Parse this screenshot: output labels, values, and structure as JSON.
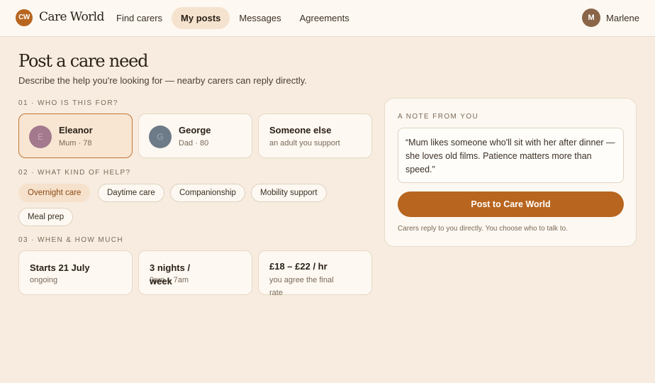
{
  "app": {
    "logo": "CW",
    "name": "Care World"
  },
  "nav": {
    "items": [
      "Find carers",
      "My posts",
      "Messages",
      "Agreements"
    ],
    "active": "My posts"
  },
  "user": {
    "initial": "M",
    "name": "Marlene"
  },
  "page": {
    "title": "Post a care need",
    "subtitle": "Describe the help you're looking for — nearby carers can reply directly."
  },
  "who": {
    "label": "01 · WHO IS THIS FOR?",
    "people": [
      {
        "name": "Eleanor",
        "meta": "Mum · 78",
        "initial": "E",
        "color": "#a3798d",
        "selected": true
      },
      {
        "name": "George",
        "meta": "Dad · 80",
        "initial": "G",
        "color": "#6d7a88",
        "selected": false
      },
      {
        "name": "Someone else",
        "meta": "an adult you support",
        "selected": false
      }
    ]
  },
  "help": {
    "label": "02 · WHAT KIND OF HELP?",
    "chips": [
      {
        "label": "Overnight care",
        "active": true
      },
      {
        "label": "Daytime care",
        "active": false
      },
      {
        "label": "Companionship",
        "active": false
      },
      {
        "label": "Mobility support",
        "active": false
      },
      {
        "label": "Meal prep",
        "active": false
      }
    ]
  },
  "when": {
    "label": "03 · WHEN & HOW MUCH",
    "cards": [
      {
        "title": "Starts 21 July",
        "meta": "ongoing"
      },
      {
        "title": "3 nights / week",
        "meta": "9pm – 7am"
      },
      {
        "title": "£18 – £22 / hr",
        "meta": "you agree the final rate"
      }
    ]
  },
  "note": {
    "label": "A NOTE FROM YOU",
    "text": "“Mum likes someone who'll sit with her after dinner — she loves old films. Patience matters more than speed.”",
    "button": "Post to Care World",
    "footer": "Carers reply to you directly. You choose who to talk to."
  },
  "colors": {
    "accent": "#b8651f",
    "background": "#f7ecdf"
  }
}
